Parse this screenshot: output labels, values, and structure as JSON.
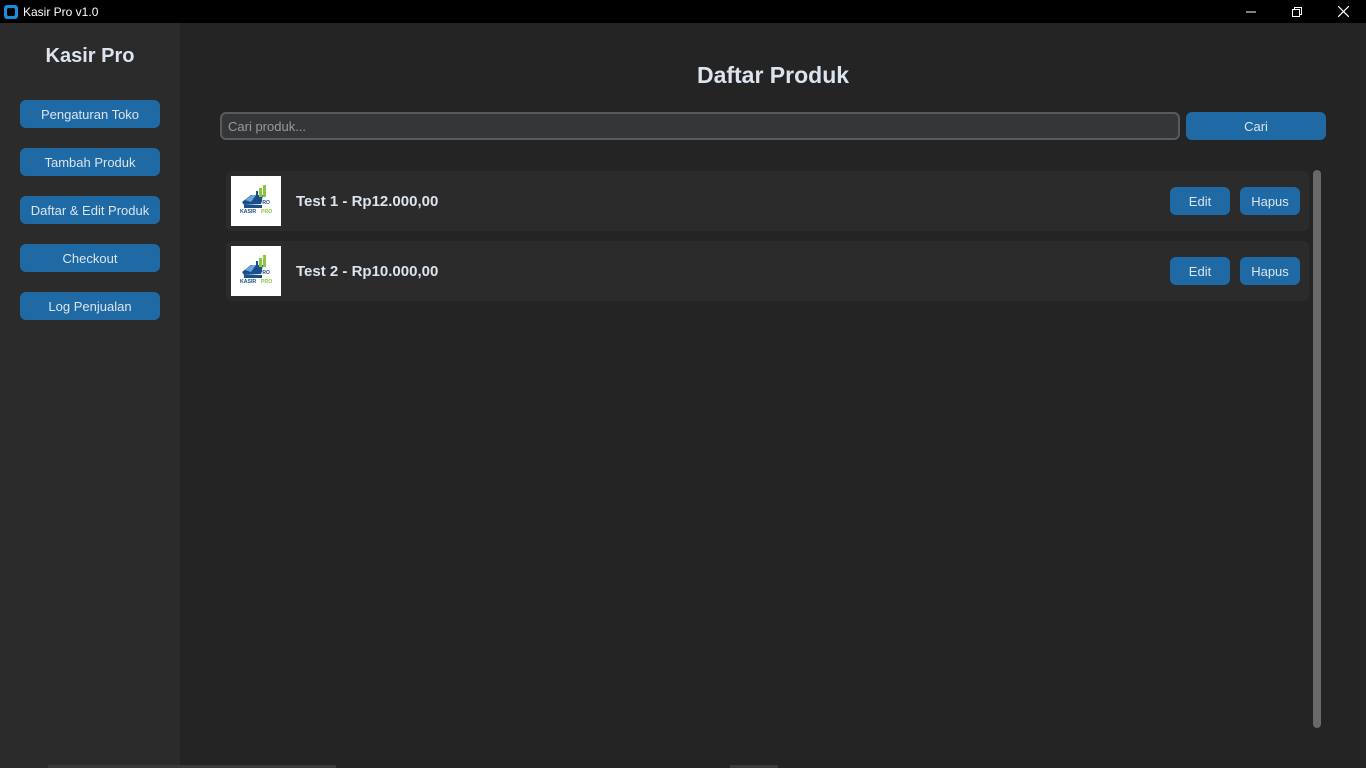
{
  "window": {
    "title": "Kasir Pro v1.0",
    "controls": [
      "minimize-icon",
      "restore-icon",
      "close-icon"
    ]
  },
  "sidebar": {
    "brand": "Kasir Pro",
    "items": [
      {
        "label": "Pengaturan Toko"
      },
      {
        "label": "Tambah Produk"
      },
      {
        "label": "Daftar & Edit Produk"
      },
      {
        "label": "Checkout"
      },
      {
        "label": "Log Penjualan"
      }
    ]
  },
  "main": {
    "title": "Daftar Produk",
    "search": {
      "placeholder": "Cari produk...",
      "value": "",
      "button_label": "Cari"
    },
    "products": [
      {
        "label": "Test 1 - Rp12.000,00",
        "edit_label": "Edit",
        "delete_label": "Hapus"
      },
      {
        "label": "Test 2 - Rp10.000,00",
        "edit_label": "Edit",
        "delete_label": "Hapus"
      }
    ]
  },
  "logo": {
    "text_line1": "KASIR",
    "text_line2": "PRO",
    "icon": "cash-register-icon"
  },
  "colors": {
    "background": "#242424",
    "sidebar": "#2b2b2b",
    "accent": "#1f6aa5",
    "text": "#dce4ee",
    "logo_green": "#8cc63f",
    "logo_blue": "#1b4f8a"
  }
}
